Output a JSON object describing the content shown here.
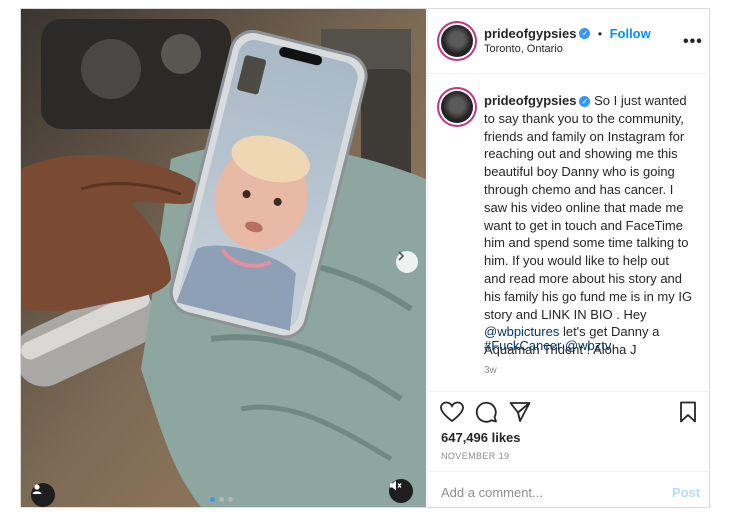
{
  "post": {
    "username": "prideofgypsies",
    "follow_label": "Follow",
    "bullet": "•",
    "location": "Toronto, Ontario",
    "more_label": "•••",
    "caption_parts": {
      "before": "So I just wanted to say thank you to the community, friends and family on Instagram for reaching out and showing me this beautiful boy Danny who is going through chemo and has cancer. I saw his video online that made me want to get in touch and FaceTime him and spend some time talking to him. If you would like to help out and read more about his story and his family his go fund me is in my IG story and LINK IN BIO . Hey ",
      "mention": "@wbpictures",
      "after": " let's get Danny a Aquaman Trident ! Aloha J"
    },
    "hashtags": "#FuckCancer @wbztv",
    "age": "3w",
    "likes": "647,496 likes",
    "date": "NOVEMBER 19",
    "comment_placeholder": "Add a comment...",
    "post_label": "Post"
  },
  "carousel": {
    "count": 3,
    "active": 0
  },
  "colors": {
    "accent": "#0095f6",
    "verified": "#3897f0",
    "muted": "#8e8e8e",
    "post_disabled": "#b2dffc"
  },
  "icons": [
    "heart-icon",
    "comment-icon",
    "share-icon",
    "bookmark-icon",
    "chevron-right-icon",
    "user-tag-icon",
    "mute-icon",
    "verified-icon"
  ]
}
